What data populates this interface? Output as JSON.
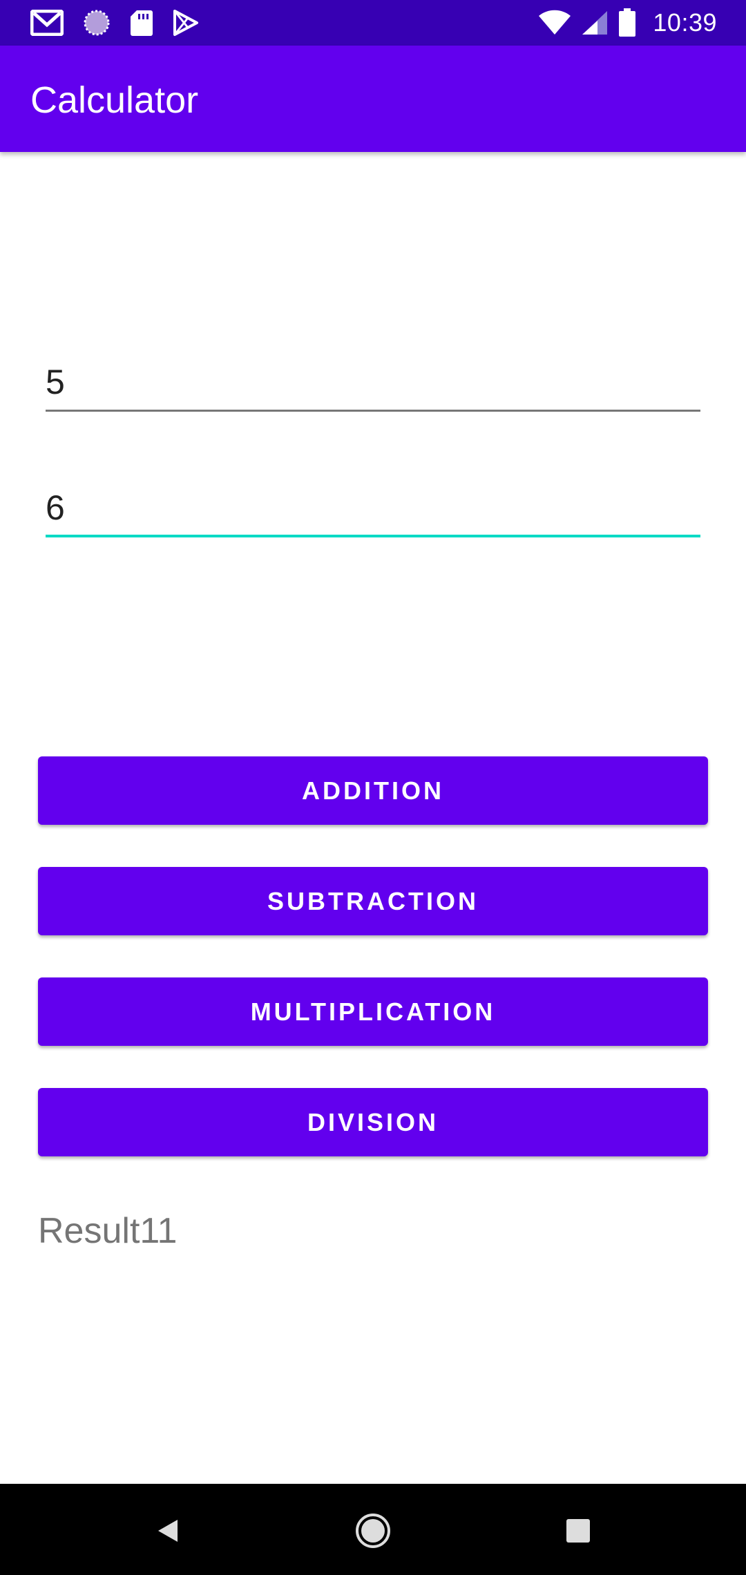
{
  "status_bar": {
    "time": "10:39",
    "left_icons": [
      "gmail-icon",
      "loading-icon",
      "sd-card-icon",
      "play-store-icon"
    ],
    "right_icons": [
      "wifi-icon",
      "cell-signal-icon",
      "battery-icon"
    ]
  },
  "app_bar": {
    "title": "Calculator"
  },
  "inputs": {
    "first_number": "5",
    "second_number": "6"
  },
  "buttons": {
    "addition": "ADDITION",
    "subtraction": "SUBTRACTION",
    "multiplication": "MULTIPLICATION",
    "division": "DIVISION"
  },
  "result": {
    "text": "Result11"
  },
  "nav_bar": {
    "icons": [
      "back-icon",
      "home-icon",
      "recents-icon"
    ]
  },
  "colors": {
    "status_bar": "#3700b3",
    "primary": "#6200ee",
    "accent": "#03dac5",
    "result_text": "#757575"
  }
}
